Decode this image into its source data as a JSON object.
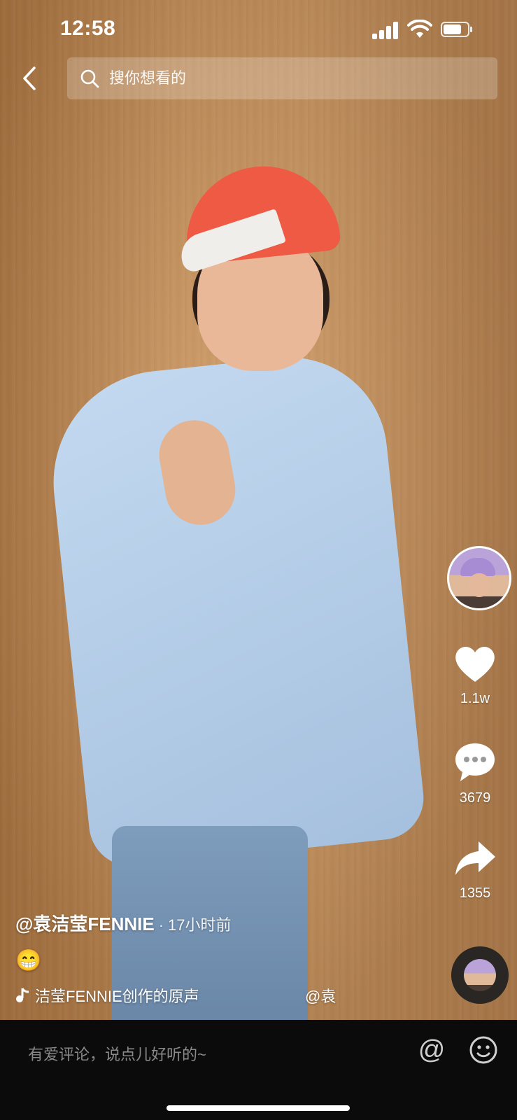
{
  "status_bar": {
    "time": "12:58"
  },
  "search": {
    "placeholder": "搜你想看的"
  },
  "video": {
    "author": "@袁洁莹FENNIE",
    "separator": "·",
    "time_ago": "17小时前",
    "caption": "😁",
    "music_text": "洁莹FENNIE创作的原声",
    "music_mention": "@袁"
  },
  "actions": {
    "likes": "1.1w",
    "comments": "3679",
    "shares": "1355"
  },
  "comment_bar": {
    "placeholder": "有爱评论，说点儿好听的~",
    "at_label": "@"
  },
  "colors": {
    "accent_white": "#ffffff",
    "comment_bar_bg": "#0b0b0b",
    "cap_red": "#ee5a43",
    "shirt_blue": "#b8d0ea"
  },
  "icons": [
    "back-icon",
    "search-icon",
    "heart-icon",
    "comment-icon",
    "share-icon",
    "music-note-icon",
    "emoji-icon"
  ]
}
